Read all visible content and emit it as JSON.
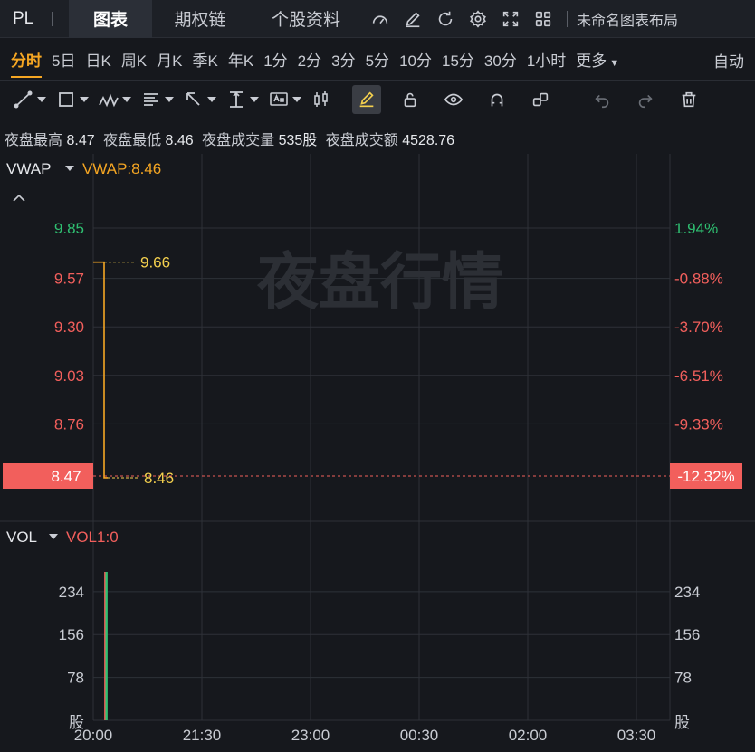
{
  "topbar": {
    "ticker": "PL",
    "tabs": [
      "图表",
      "期权链",
      "个股资料"
    ],
    "active_tab": "图表",
    "layout_name": "未命名图表布局",
    "icons": [
      "gauge-icon",
      "pencil-icon",
      "refresh-icon",
      "gear-icon",
      "fullscreen-icon",
      "grid-icon"
    ]
  },
  "periods": {
    "items": [
      "分时",
      "5日",
      "日K",
      "周K",
      "月K",
      "季K",
      "年K",
      "1分",
      "2分",
      "3分",
      "5分",
      "10分",
      "15分",
      "30分",
      "1小时",
      "更多"
    ],
    "active": "分时",
    "right_label": "自动"
  },
  "drawbar": {
    "icons": [
      "trend-line-icon",
      "rectangle-icon",
      "wave-icon",
      "fib-icon",
      "arrow-icon",
      "measure-icon",
      "text-icon",
      "candle-icon",
      "highlighter-icon",
      "lock-icon",
      "eye-icon",
      "magnet-icon",
      "link-icon",
      "undo-icon",
      "redo-icon",
      "trash-icon"
    ]
  },
  "stats": {
    "high_label": "夜盘最高",
    "high": "8.47",
    "low_label": "夜盘最低",
    "low": "8.46",
    "vol_label": "夜盘成交量",
    "vol": "535股",
    "amt_label": "夜盘成交额",
    "amt": "4528.76"
  },
  "chart_data": {
    "type": "line",
    "watermark": "夜盘行情",
    "price": {
      "indicator": "VWAP",
      "indicator_value_label": "VWAP:8.46",
      "ylim": [
        8.47,
        9.85
      ],
      "yticks": [
        "9.85",
        "9.57",
        "9.30",
        "9.03",
        "8.76",
        "8.47"
      ],
      "pct_ticks": [
        "1.94%",
        "-0.88%",
        "-3.70%",
        "-6.51%",
        "-9.33%",
        "-12.32%"
      ],
      "current": "8.47",
      "current_pct": "-12.32%",
      "series": [
        {
          "x": [
            "20:00",
            "20:09",
            "20:09",
            "20:12"
          ],
          "values": [
            9.66,
            9.66,
            8.46,
            8.46
          ]
        }
      ],
      "annotations": [
        {
          "x": "20:09",
          "value": 9.66,
          "label": "9.66"
        },
        {
          "x": "20:12",
          "value": 8.46,
          "label": "8.46"
        }
      ],
      "colors": {
        "up": "#2fbf71",
        "down": "#f25f5c",
        "line": "#f5a623",
        "hl": "#f5d14e"
      }
    },
    "volume": {
      "indicator": "VOL",
      "indicator_value_label": "VOL1:0",
      "ylim": [
        0,
        270
      ],
      "yticks": [
        "234",
        "156",
        "78"
      ],
      "unit": "股",
      "bars": [
        {
          "x": "20:10",
          "value": 270,
          "color": "#f25f5c"
        },
        {
          "x": "20:11",
          "value": 270,
          "color": "#2fbf71"
        }
      ]
    },
    "xaxis": {
      "ticks": [
        "20:00",
        "21:30",
        "23:00",
        "00:30",
        "02:00",
        "03:30"
      ]
    }
  }
}
